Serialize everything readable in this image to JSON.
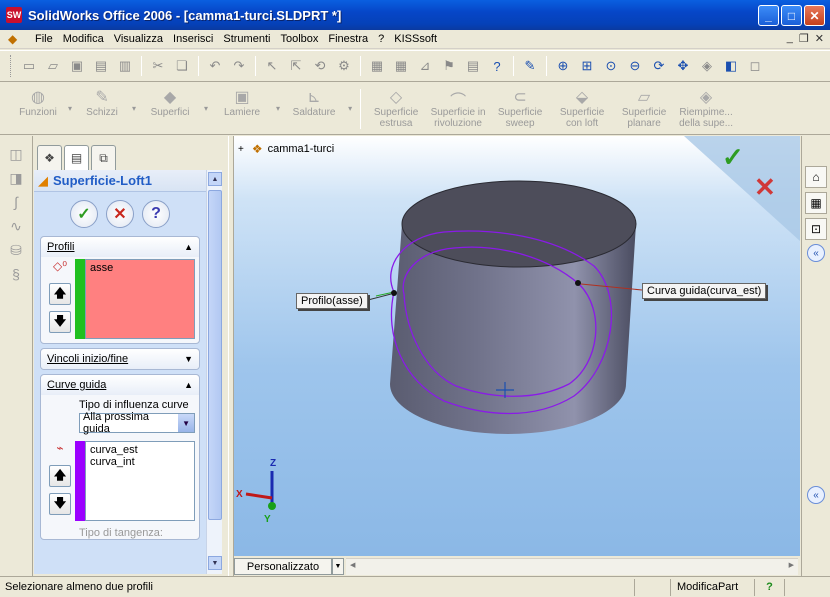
{
  "window": {
    "app_icon": "SW",
    "title": "SolidWorks Office 2006 - [camma1-turci.SLDPRT *]",
    "minimize": "_",
    "maximize": "□",
    "close": "✕"
  },
  "menu": {
    "items": [
      "File",
      "Modifica",
      "Visualizza",
      "Inserisci",
      "Strumenti",
      "Toolbox",
      "Finestra",
      "?",
      "KISSsoft"
    ],
    "mdi_min": "_",
    "mdi_restore": "❐",
    "mdi_close": "✕"
  },
  "features_toolbar": {
    "items": [
      {
        "label": "Funzioni",
        "icon": "features-icon"
      },
      {
        "label": "Schizzi",
        "icon": "sketch-icon"
      },
      {
        "label": "Superfici",
        "icon": "surfaces-icon"
      },
      {
        "label": "Lamiere",
        "icon": "sheetmetal-icon"
      },
      {
        "label": "Saldature",
        "icon": "weldments-icon"
      }
    ],
    "surface_tools": [
      {
        "line1": "Superficie",
        "line2": "estrusa"
      },
      {
        "line1": "Superficie in",
        "line2": "rivoluzione"
      },
      {
        "line1": "Superficie",
        "line2": "sweep"
      },
      {
        "line1": "Superficie",
        "line2": "con loft"
      },
      {
        "line1": "Superficie",
        "line2": "planare"
      },
      {
        "line1": "Riempime...",
        "line2": "della supe..."
      }
    ]
  },
  "property_manager": {
    "title": "Superficie-Loft1",
    "ok_symbol": "✓",
    "cancel_symbol": "✕",
    "help_symbol": "?",
    "profili": {
      "label": "Profili",
      "items": [
        "asse"
      ],
      "color": "#ff8080"
    },
    "vincoli": {
      "label": "Vincoli inizio/fine"
    },
    "curve_guida": {
      "label": "Curve guida",
      "influence_label": "Tipo di influenza curve",
      "influence_value": "Alla prossima guida",
      "items": [
        "curva_est",
        "curva_int"
      ],
      "bar_color": "#9b00ff",
      "tangency_label": "Tipo di tangenza:"
    },
    "up_symbol": "🡅",
    "down_symbol": "🡇"
  },
  "viewport": {
    "tree_root": "camma1-turci",
    "callout_profile": "Profilo(asse)",
    "callout_guide": "Curva guida(curva_est)",
    "triad": {
      "x": "X",
      "y": "Y",
      "z": "Z"
    },
    "config_tab": "Personalizzato"
  },
  "status": {
    "message": "Selezionare almeno due profili",
    "mode": "ModificaPart",
    "help": "?"
  }
}
